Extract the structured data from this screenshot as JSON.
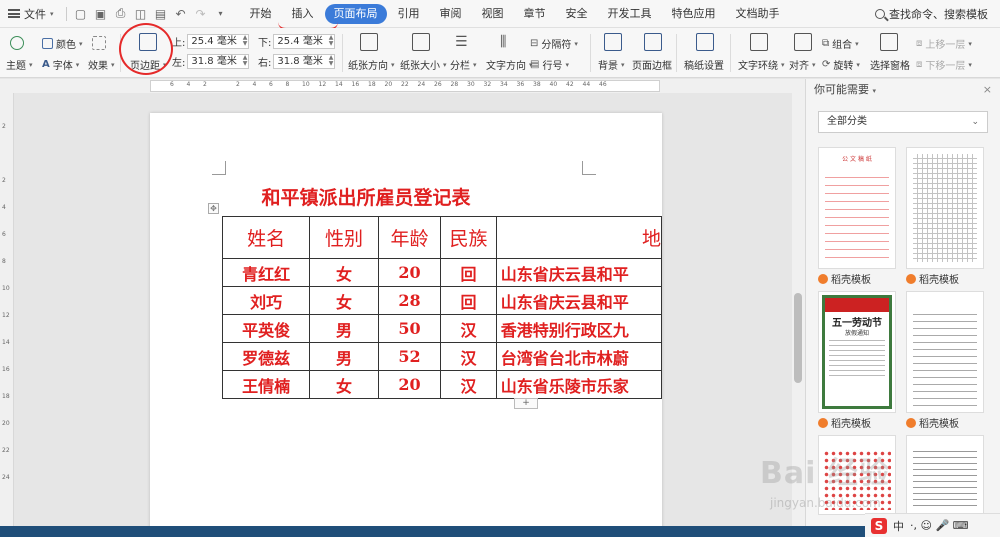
{
  "menubar": {
    "file_label": "文件",
    "tabs": [
      "开始",
      "插入",
      "页面布局",
      "引用",
      "审阅",
      "视图",
      "章节",
      "安全",
      "开发工具",
      "特色应用",
      "文档助手"
    ],
    "active_tab": "页面布局",
    "search_label": "查找命令、搜索模板"
  },
  "ribbon": {
    "theme": "主题",
    "color": "颜色",
    "font": "字体",
    "effect": "效果",
    "margins": "页边距",
    "top_label": "上:",
    "top_value": "25.4 毫米",
    "bottom_label": "下:",
    "bottom_value": "25.4 毫米",
    "left_label": "左:",
    "left_value": "31.8 毫米",
    "right_label": "右:",
    "right_value": "31.8 毫米",
    "orientation": "纸张方向",
    "size": "纸张大小",
    "columns": "分栏",
    "text_direction": "文字方向",
    "breaks": "分隔符",
    "line_numbers": "行号",
    "background": "背景",
    "page_border": "页面边框",
    "draft_settings": "稿纸设置",
    "wrap_text": "文字环绕",
    "align": "对齐",
    "group": "组合",
    "rotate": "旋转",
    "selection_pane": "选择窗格",
    "bring_forward": "上移一层",
    "send_backward": "下移一层"
  },
  "ruler": {
    "h_ticks": [
      "6",
      "4",
      "2",
      "",
      "2",
      "4",
      "6",
      "8",
      "10",
      "12",
      "14",
      "16",
      "18",
      "20",
      "22",
      "24",
      "26",
      "28",
      "30",
      "32",
      "34",
      "36",
      "38",
      "40",
      "42",
      "44",
      "46"
    ],
    "v_ticks": [
      "2",
      "",
      "2",
      "4",
      "6",
      "8",
      "10",
      "12",
      "14",
      "16",
      "18",
      "20",
      "22",
      "24"
    ]
  },
  "document": {
    "title": "和平镇派出所雇员登记表",
    "table": {
      "headers": [
        "姓名",
        "性别",
        "年龄",
        "民族",
        "地"
      ],
      "rows": [
        [
          "青红红",
          "女",
          "20",
          "回",
          "山东省庆云县和平"
        ],
        [
          "刘巧",
          "女",
          "28",
          "回",
          "山东省庆云县和平"
        ],
        [
          "平英俊",
          "男",
          "50",
          "汉",
          "香港特别行政区九"
        ],
        [
          "罗德兹",
          "男",
          "52",
          "汉",
          "台湾省台北市林蔚"
        ],
        [
          "王倩楠",
          "女",
          "20",
          "汉",
          "山东省乐陵市乐家"
        ]
      ]
    },
    "add_row": "+",
    "move_handle": "✥"
  },
  "right_panel": {
    "title": "你可能需要",
    "close": "×",
    "category": "全部分类",
    "card_label": "稻壳模板",
    "card1_title": "公 文 稿 纸",
    "card3_title": "五一劳动节",
    "card3_sub": "放假通知"
  },
  "tray": {
    "ime": "中",
    "extra": "·,  ☺ 🎤 ⌨"
  },
  "watermark": {
    "brand": "Bai 经验",
    "url": "jingyan.baidu.com"
  },
  "colors": {
    "accent": "#3b7bd9",
    "doc_text": "#e02020",
    "annotation": "#e52a2a"
  }
}
